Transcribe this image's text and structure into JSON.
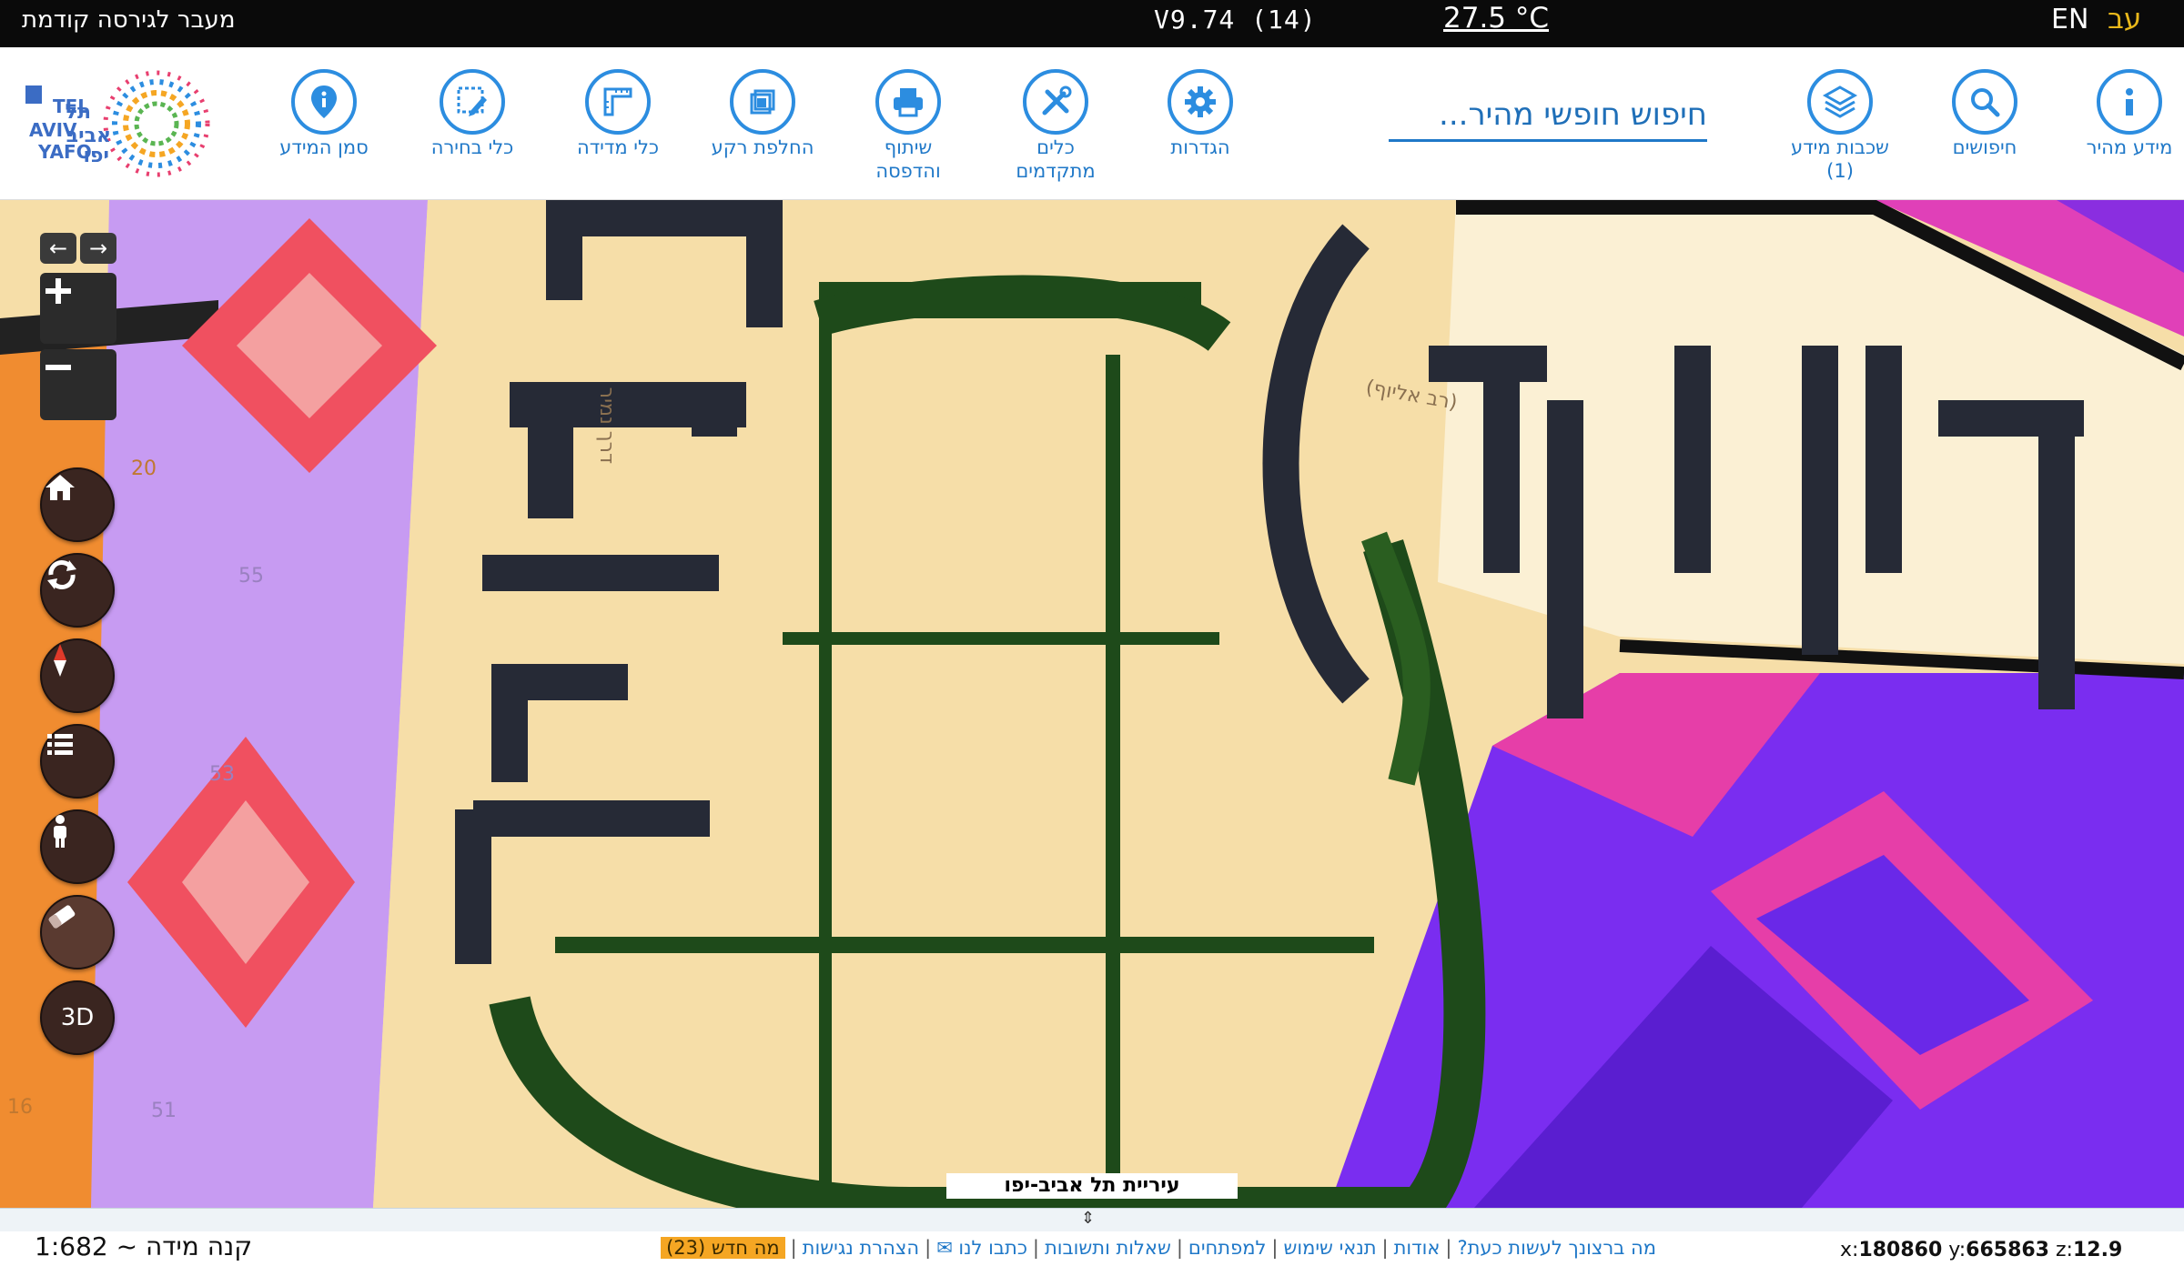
{
  "topbar": {
    "prev_version": "מעבר לגירסה קודמת",
    "version": "V9.74 (14)",
    "temperature": "27.5 °C",
    "lang_en": "EN",
    "lang_he": "עב"
  },
  "toolbar": {
    "tools": [
      {
        "label": "מידע מהיר",
        "icon": "info-icon"
      },
      {
        "label": "חיפושים",
        "icon": "search-icon"
      },
      {
        "label": "שכבות מידע",
        "sub": "(1)",
        "icon": "layers-icon"
      },
      {
        "label": "הגדרות",
        "icon": "gear-icon"
      },
      {
        "label": "כלים",
        "sub": "מתקדמים",
        "icon": "tools-icon"
      },
      {
        "label": "שיתוף",
        "sub": "והדפסה",
        "icon": "print-icon"
      },
      {
        "label": "החלפת רקע",
        "icon": "background-icon"
      },
      {
        "label": "כלי מדידה",
        "icon": "ruler-icon"
      },
      {
        "label": "כלי בחירה",
        "icon": "select-icon"
      },
      {
        "label": "סמן המידע",
        "icon": "pin-icon"
      }
    ],
    "search_placeholder": "חיפוש חופשי מהיר..."
  },
  "logo": {
    "text_en": "TEL AVIV YAFO",
    "text_he": "תל אביב יפו"
  },
  "map": {
    "city_label": "עיריית תל אביב-יפו",
    "map_labels": [
      "גליוף",
      "(רב אליוף)",
      "דרך נמיר",
      "55",
      "53",
      "51",
      "20",
      "16"
    ]
  },
  "controls": {
    "three_d": "3D"
  },
  "bottom": {
    "scale": "קנה מידה ~ 1:682",
    "links": [
      "מה ברצונך לעשות כעת?",
      "אודות",
      "תנאי שימוש",
      "למפתחים",
      "שאלות ותשובות",
      "כתבו לנו ✉",
      "הצהרת נגישות"
    ],
    "whats_new": "מה חדש (23)",
    "coords": {
      "x": "180860",
      "y": "665863",
      "z": "12.9"
    }
  },
  "colors": {
    "accent": "#2c8de0",
    "brand_yellow": "#e9b81b"
  }
}
